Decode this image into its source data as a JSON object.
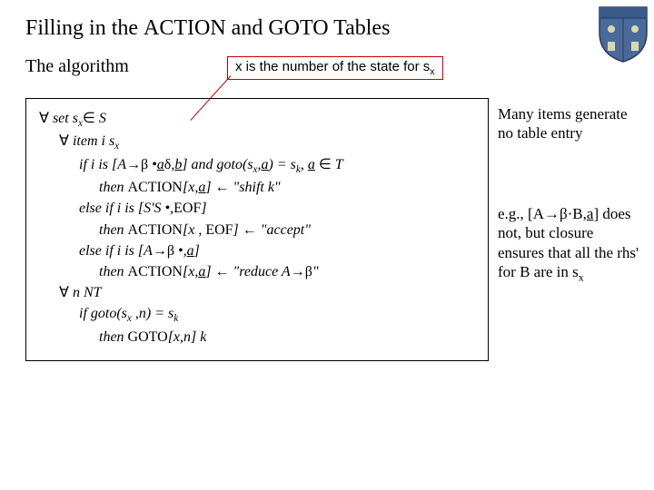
{
  "title": {
    "pre": "Filling in the ",
    "action": "ACTION",
    "mid": " and ",
    "goto": "GOTO",
    "post": " Tables"
  },
  "subtitle": "The algorithm",
  "annotation": "x is the number of the state for s",
  "annotation_sub": "x",
  "algo": {
    "l1a": " set s",
    "l1b": "x",
    "l1c": "  S",
    "l2a": " item i  s",
    "l2b": "x",
    "l3a": "if  i is [A",
    "l3b": " •",
    "l3c": "a",
    "l3d": "d",
    "l3e": ",",
    "l3f": "b",
    "l3g": "] and goto(s",
    "l3h": "x",
    "l3i": ",",
    "l3j": "a",
    "l3k": ") = s",
    "l3l": "k",
    "l3m": ", ",
    "l3n": "a",
    "l3o": "  T",
    "l4a": "then ",
    "l4b": "ACTION",
    "l4c": "[x,",
    "l4d": "a",
    "l4e": "]  \"shift k\"",
    "l5a": "else if  i is [S'S •,",
    "l5b": "EOF",
    "l5c": "]",
    "l6a": "then ",
    "l6b": "ACTION",
    "l6c": "[x , ",
    "l6d": "EOF",
    "l6e": "]  \"accept\"",
    "l7a": "else if  i is [A",
    "l7b": " •,",
    "l7c": "a",
    "l7d": "]",
    "l8a": "then ",
    "l8b": "ACTION",
    "l8c": "[x,",
    "l8d": "a",
    "l8e": "]  \"reduce A",
    "l8f": "\"",
    "l9a": " n  NT",
    "l10a": "if  goto(s",
    "l10b": "x",
    "l10c": " ,n) = s",
    "l10d": "k",
    "l11a": "then ",
    "l11b": "GOTO",
    "l11c": "[x,n]  k"
  },
  "side1": "Many items generate no table entry",
  "side2": {
    "a": "e.g., [A",
    "b": "·B",
    "c": ",",
    "d": "a",
    "e": "] does not, but closure ensures that all the rhs' for B are in s",
    "f": "x"
  },
  "sym": {
    "forall": "∀",
    "in": "∈",
    "rarr": "→",
    "larr": "←",
    "beta": "β",
    "delta": "δ"
  }
}
